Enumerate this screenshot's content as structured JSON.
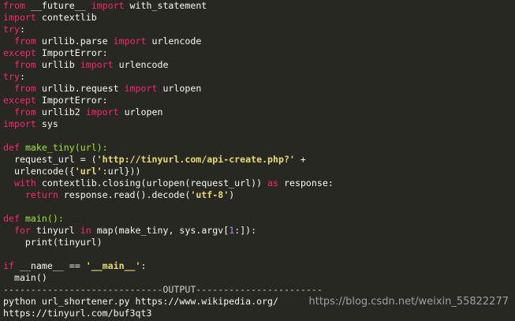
{
  "editor": {
    "background": "#272822",
    "colors": {
      "keyword": "#f92672",
      "text": "#f8f8f2",
      "function": "#a6e22e",
      "string": "#e6db74",
      "number": "#ae81ff"
    },
    "lines": [
      [
        {
          "t": "from",
          "c": "kw"
        },
        {
          "t": " __future__ ",
          "c": "plain"
        },
        {
          "t": "import",
          "c": "kw"
        },
        {
          "t": " with_statement",
          "c": "plain"
        }
      ],
      [
        {
          "t": "import",
          "c": "kw"
        },
        {
          "t": " contextlib",
          "c": "plain"
        }
      ],
      [
        {
          "t": "try",
          "c": "kw"
        },
        {
          "t": ":",
          "c": "plain"
        }
      ],
      [
        {
          "t": "  ",
          "c": "plain"
        },
        {
          "t": "from",
          "c": "kw"
        },
        {
          "t": " urllib.parse ",
          "c": "plain"
        },
        {
          "t": "import",
          "c": "kw"
        },
        {
          "t": " urlencode",
          "c": "plain"
        }
      ],
      [
        {
          "t": "except",
          "c": "kw"
        },
        {
          "t": " ImportError:",
          "c": "plain"
        }
      ],
      [
        {
          "t": "  ",
          "c": "plain"
        },
        {
          "t": "from",
          "c": "kw"
        },
        {
          "t": " urllib ",
          "c": "plain"
        },
        {
          "t": "import",
          "c": "kw"
        },
        {
          "t": " urlencode",
          "c": "plain"
        }
      ],
      [
        {
          "t": "try",
          "c": "kw"
        },
        {
          "t": ":",
          "c": "plain"
        }
      ],
      [
        {
          "t": "  ",
          "c": "plain"
        },
        {
          "t": "from",
          "c": "kw"
        },
        {
          "t": " urllib.request ",
          "c": "plain"
        },
        {
          "t": "import",
          "c": "kw"
        },
        {
          "t": " urlopen",
          "c": "plain"
        }
      ],
      [
        {
          "t": "except",
          "c": "kw"
        },
        {
          "t": " ImportError:",
          "c": "plain"
        }
      ],
      [
        {
          "t": "  ",
          "c": "plain"
        },
        {
          "t": "from",
          "c": "kw"
        },
        {
          "t": " urllib2 ",
          "c": "plain"
        },
        {
          "t": "import",
          "c": "kw"
        },
        {
          "t": " urlopen",
          "c": "plain"
        }
      ],
      [
        {
          "t": "import",
          "c": "kw"
        },
        {
          "t": " sys",
          "c": "plain"
        }
      ],
      [],
      [
        {
          "t": "def",
          "c": "kw"
        },
        {
          "t": " ",
          "c": "plain"
        },
        {
          "t": "make_tiny",
          "c": "func"
        },
        {
          "t": "(url):",
          "c": "func"
        }
      ],
      [
        {
          "t": "  request_url = (",
          "c": "plain"
        },
        {
          "t": "'http://tinyurl.com/api-create.php?'",
          "c": "str"
        },
        {
          "t": " +",
          "c": "plain"
        }
      ],
      [
        {
          "t": "  urlencode({",
          "c": "plain"
        },
        {
          "t": "'url'",
          "c": "str"
        },
        {
          "t": ":url}))",
          "c": "plain"
        }
      ],
      [
        {
          "t": "  ",
          "c": "plain"
        },
        {
          "t": "with",
          "c": "kw"
        },
        {
          "t": " contextlib.closing(urlopen(request_url)) ",
          "c": "plain"
        },
        {
          "t": "as",
          "c": "kw"
        },
        {
          "t": " response:",
          "c": "plain"
        }
      ],
      [
        {
          "t": "    ",
          "c": "plain"
        },
        {
          "t": "return",
          "c": "kw"
        },
        {
          "t": " response.read().decode(",
          "c": "plain"
        },
        {
          "t": "'utf-8'",
          "c": "str"
        },
        {
          "t": ")",
          "c": "plain"
        }
      ],
      [],
      [
        {
          "t": "def",
          "c": "kw"
        },
        {
          "t": " ",
          "c": "plain"
        },
        {
          "t": "main",
          "c": "func"
        },
        {
          "t": "():",
          "c": "func"
        }
      ],
      [
        {
          "t": "  ",
          "c": "plain"
        },
        {
          "t": "for",
          "c": "kw"
        },
        {
          "t": " tinyurl ",
          "c": "plain"
        },
        {
          "t": "in",
          "c": "kw"
        },
        {
          "t": " map(make_tiny, sys.argv[",
          "c": "plain"
        },
        {
          "t": "1",
          "c": "num"
        },
        {
          "t": ":]):",
          "c": "plain"
        }
      ],
      [
        {
          "t": "    print(tinyurl)",
          "c": "plain"
        }
      ],
      [],
      [
        {
          "t": "if",
          "c": "kw"
        },
        {
          "t": " __name__ == ",
          "c": "plain"
        },
        {
          "t": "'__main__'",
          "c": "str"
        },
        {
          "t": ":",
          "c": "plain"
        }
      ],
      [
        {
          "t": "  main()",
          "c": "plain"
        }
      ],
      [
        {
          "t": "-----------------------------OUTPUT-----------------------",
          "c": "sep"
        }
      ],
      [
        {
          "t": "python url_shortener.py https://www.wikipedia.org/",
          "c": "out"
        }
      ],
      [
        {
          "t": "https://tinyurl.com/buf3qt3",
          "c": "out"
        }
      ]
    ]
  },
  "watermark": {
    "text": "https://blog.csdn.net/weixin_55822277"
  }
}
